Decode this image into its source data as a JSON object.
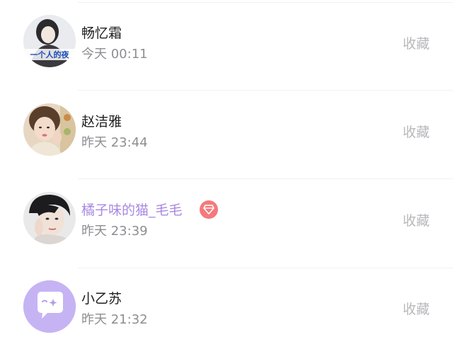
{
  "list": {
    "items": [
      {
        "name": "畅忆霜",
        "time": "今天 00:11",
        "action": "收藏",
        "avatar_caption": "一个人的夜"
      },
      {
        "name": "赵洁雅",
        "time": "昨天 23:44",
        "action": "收藏"
      },
      {
        "name": "橘子味的猫_毛毛",
        "time": "昨天 23:39",
        "action": "收藏"
      },
      {
        "name": "小乙苏",
        "time": "昨天 21:32",
        "action": "收藏"
      }
    ]
  },
  "colors": {
    "vip_name": "#a889e0",
    "vip_badge": "#f47a7c",
    "action_text": "#b8b8bc",
    "time_text": "#8e8e93"
  }
}
